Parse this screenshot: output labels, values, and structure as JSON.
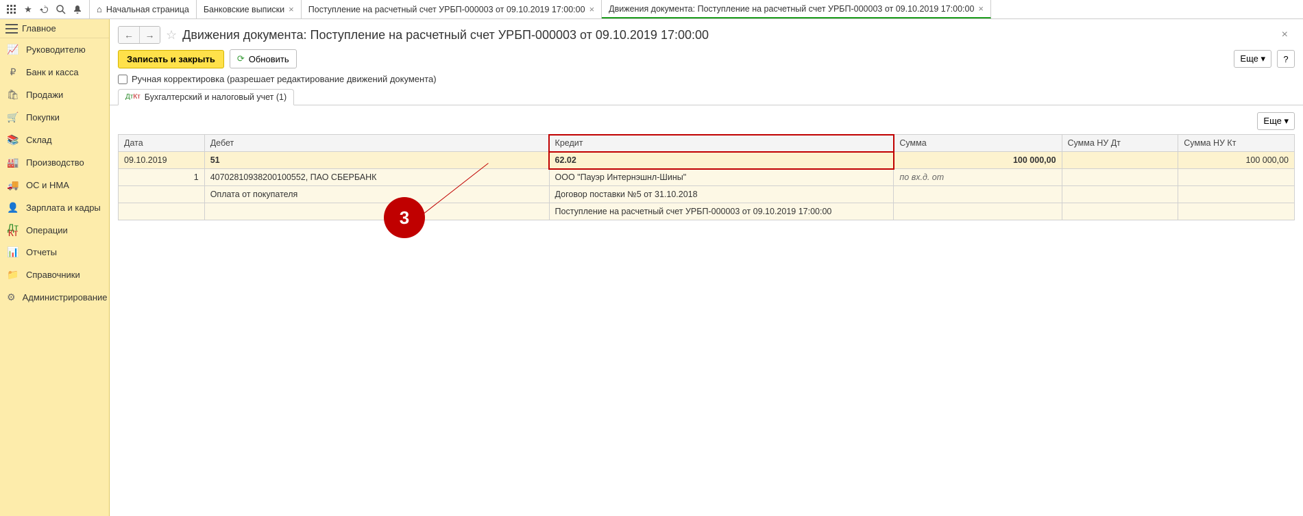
{
  "toolbar": {
    "icons": [
      "grid",
      "star",
      "history",
      "search",
      "bell"
    ]
  },
  "tabs": [
    {
      "label": "Начальная страница",
      "closable": false,
      "home": true
    },
    {
      "label": "Банковские выписки",
      "closable": true
    },
    {
      "label": "Поступление на расчетный счет УРБП-000003 от 09.10.2019 17:00:00",
      "closable": true
    },
    {
      "label": "Движения документа: Поступление на расчетный счет УРБП-000003 от 09.10.2019 17:00:00",
      "closable": true,
      "active": true
    }
  ],
  "sidebar": {
    "top": "Главное",
    "items": [
      {
        "icon": "chart",
        "label": "Руководителю"
      },
      {
        "icon": "ruble",
        "label": "Банк и касса"
      },
      {
        "icon": "box",
        "label": "Продажи"
      },
      {
        "icon": "cart",
        "label": "Покупки"
      },
      {
        "icon": "stack",
        "label": "Склад"
      },
      {
        "icon": "factory",
        "label": "Производство"
      },
      {
        "icon": "truck",
        "label": "ОС и НМА"
      },
      {
        "icon": "person",
        "label": "Зарплата и кадры"
      },
      {
        "icon": "dtkt",
        "label": "Операции"
      },
      {
        "icon": "bars",
        "label": "Отчеты"
      },
      {
        "icon": "folder",
        "label": "Справочники"
      },
      {
        "icon": "gear",
        "label": "Администрирование"
      }
    ]
  },
  "page": {
    "title": "Движения документа: Поступление на расчетный счет УРБП-000003 от 09.10.2019 17:00:00",
    "save_close": "Записать и закрыть",
    "refresh": "Обновить",
    "more": "Еще",
    "help": "?",
    "manual_label": "Ручная корректировка (разрешает редактирование движений документа)",
    "sheet_tab": "Бухгалтерский и налоговый учет (1)"
  },
  "grid": {
    "headers": {
      "date": "Дата",
      "debit": "Дебет",
      "credit": "Кредит",
      "sum": "Сумма",
      "sum_nu_dt": "Сумма НУ Дт",
      "sum_nu_kt": "Сумма НУ Кт"
    },
    "row1": {
      "date": "09.10.2019",
      "debit_acc": "51",
      "credit_acc": "62.02",
      "sum": "100 000,00",
      "sum_nu_kt": "100 000,00"
    },
    "row2": {
      "n": "1",
      "debit_sub": "40702810938200100552, ПАО СБЕРБАНК",
      "credit_sub": "ООО \"Пауэр Интернэшнл-Шины\"",
      "sum_note": "по вх.д.  от"
    },
    "row3": {
      "debit_sub": "Оплата от покупателя",
      "credit_sub": "Договор поставки №5 от 31.10.2018"
    },
    "row4": {
      "credit_sub": "Поступление на расчетный счет УРБП-000003 от 09.10.2019 17:00:00"
    }
  },
  "annotation": {
    "badge": "3"
  }
}
